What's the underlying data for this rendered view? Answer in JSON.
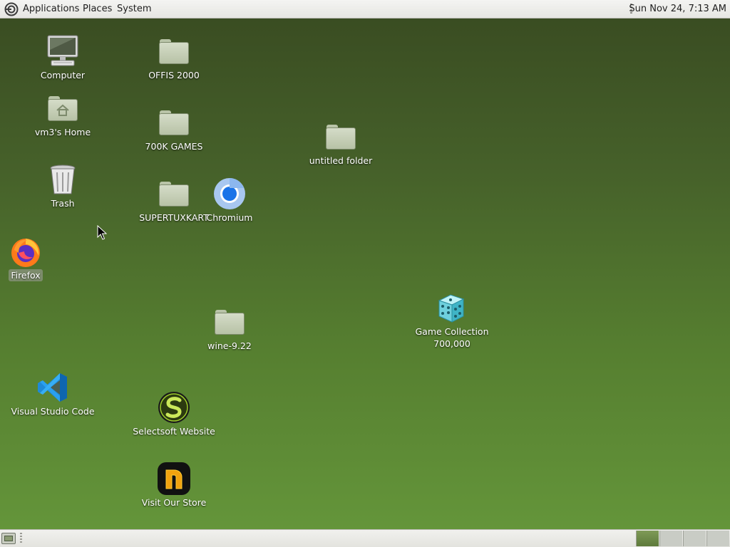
{
  "top_panel": {
    "menus": {
      "applications": "Applications",
      "places": "Places",
      "system": "System"
    },
    "clock": "Sun Nov 24,  7:13 AM"
  },
  "desktop": {
    "background_colors": [
      "#3a4d22",
      "#64953a"
    ],
    "icons": {
      "computer": {
        "label": "Computer",
        "icon": "computer-icon"
      },
      "home": {
        "label": "vm3's Home",
        "icon": "home-folder-icon"
      },
      "trash": {
        "label": "Trash",
        "icon": "trash-icon"
      },
      "firefox": {
        "label": "Firefox",
        "icon": "firefox-icon"
      },
      "vscode": {
        "label": "Visual Studio Code",
        "icon": "vscode-icon"
      },
      "offis": {
        "label": "OFFIS 2000",
        "icon": "folder-icon"
      },
      "games700k": {
        "label": "700K GAMES",
        "icon": "folder-icon"
      },
      "supertuxkart": {
        "label": "SUPERTUXKART",
        "icon": "folder-icon"
      },
      "chromium": {
        "label": "Chromium",
        "icon": "chromium-icon"
      },
      "untitled": {
        "label": "untitled folder",
        "icon": "folder-icon"
      },
      "wine": {
        "label": "wine-9.22",
        "icon": "folder-icon"
      },
      "gamecollection": {
        "label": "Game Collection\n700,000",
        "icon": "dice-icon"
      },
      "selectsoft": {
        "label": "Selectsoft Website",
        "icon": "selectsoft-icon"
      },
      "store": {
        "label": "Visit Our Store",
        "icon": "store-icon"
      }
    }
  },
  "bottom_panel": {
    "workspaces": 4,
    "active_workspace": 1
  }
}
